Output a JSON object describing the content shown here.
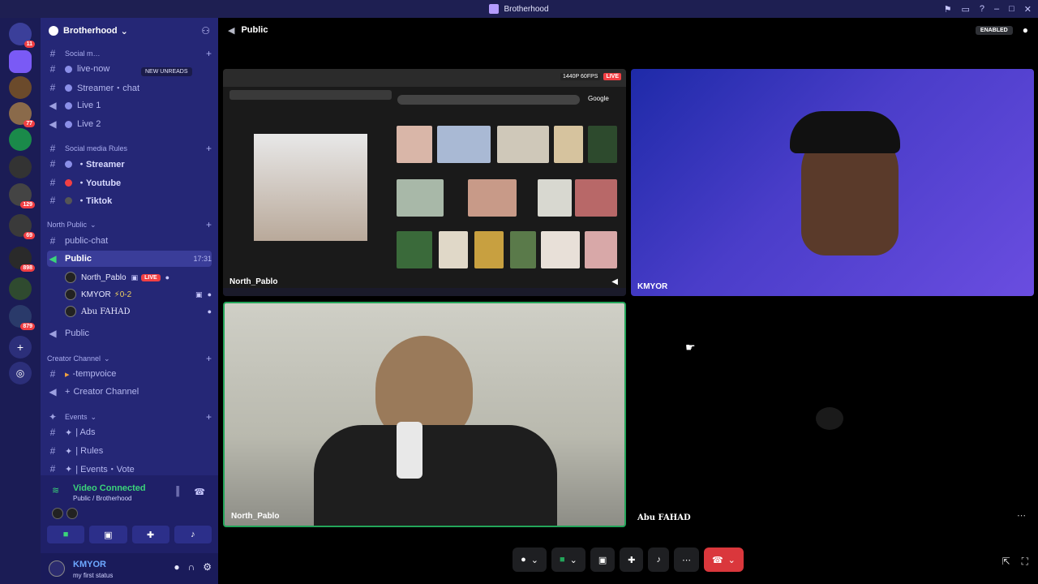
{
  "window": {
    "title": "Brotherhood",
    "controls": [
      "⚑",
      "▭",
      "?",
      "–",
      "□",
      "✕"
    ]
  },
  "server_rail": {
    "badges": [
      "11",
      "77",
      "129",
      "69",
      "898",
      "879"
    ]
  },
  "sidebar": {
    "guild_name": "Brotherhood",
    "new_unreads": "NEW UNREADS",
    "categories": [
      {
        "label": "Social m…",
        "channels": [
          "live-now",
          "Streamer・chat",
          "Live 1",
          "Live 2"
        ]
      },
      {
        "label": "Social media Rules",
        "channels": [
          "・Streamer",
          "・Youtube",
          "・Tiktok"
        ]
      },
      {
        "label": "North Public",
        "channels": [
          "public-chat",
          "Public"
        ]
      },
      {
        "label": "Creator Channel",
        "channels": [
          "-tempvoice",
          "Creator Channel"
        ]
      },
      {
        "label": "Events",
        "channels": [
          "| Ads",
          "| Rules",
          "| Events・Vote"
        ]
      }
    ],
    "active_channel_time": "17:31",
    "voice_users": [
      {
        "name": "North_Pablo",
        "live": "LIVE"
      },
      {
        "name": "KMYOR",
        "extra": "⚡0-2"
      },
      {
        "name": "Abu FAHAD"
      }
    ],
    "second_public": "Public"
  },
  "voice_panel": {
    "title": "Video Connected",
    "subtitle": "Public / Brotherhood"
  },
  "user_bar": {
    "name": "KMYOR",
    "status": "my first status"
  },
  "stage": {
    "channel_name": "Public",
    "enabled": "ENABLED",
    "tiles": {
      "screen_label": "North_Pablo",
      "quality": "1440P 60FPS",
      "live": "LIVE",
      "kmyor_label": "KMYOR",
      "np_label": "North_Pablo",
      "af_label": "Abu FAHAD"
    },
    "screen_search_logo": "Google"
  },
  "colors": {
    "sidebar_bg": "#252776",
    "rail_bg": "#1b1c55",
    "connected_green": "#3bd47a",
    "live_red": "#f23f43",
    "hangup_red": "#da373c"
  }
}
